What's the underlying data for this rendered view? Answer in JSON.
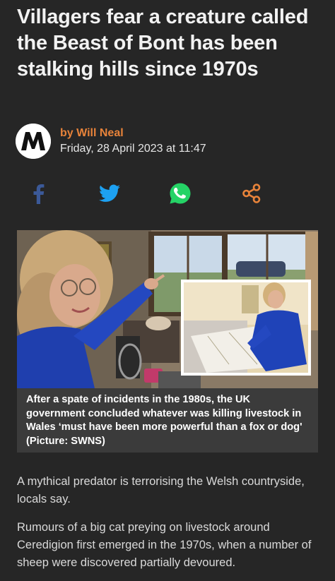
{
  "article": {
    "headline": "Villagers fear a creature called the Beast of Bont has been stalking hills since 1970s",
    "author": "by Will Neal",
    "date": "Friday, 28 April 2023 at 11:47",
    "image_caption": "After a spate of incidents in the 1980s, the UK government concluded whatever was killing livestock in Wales ‘must have been more powerful than a fox or dog' (Picture: SWNS)",
    "paragraphs": [
      "A mythical predator is terrorising the Welsh countryside, locals say.",
      "Rumours of a big cat preying on livestock around Ceredigion first emerged in the 1970s, when a number of sheep were discovered partially devoured."
    ]
  },
  "share": [
    {
      "name": "facebook-icon",
      "color": "#3b5998"
    },
    {
      "name": "twitter-icon",
      "color": "#1da1f2"
    },
    {
      "name": "whatsapp-icon",
      "color": "#25d366"
    },
    {
      "name": "share-icon",
      "color": "#e8833a"
    }
  ],
  "colors": {
    "background": "#262626",
    "author_accent": "#e8833a",
    "caption_background": "#3b3b3b"
  }
}
